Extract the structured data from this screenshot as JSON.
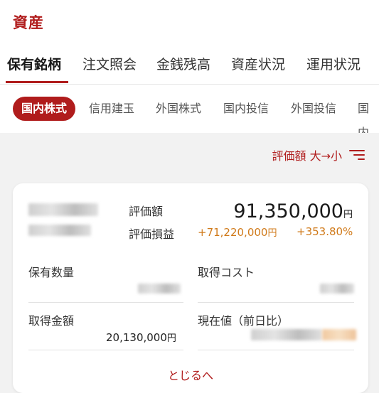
{
  "header": {
    "title": "資産"
  },
  "tabs": [
    {
      "label": "保有銘柄",
      "active": true
    },
    {
      "label": "注文照会",
      "active": false
    },
    {
      "label": "金銭残高",
      "active": false
    },
    {
      "label": "資産状況",
      "active": false
    },
    {
      "label": "運用状況",
      "active": false
    }
  ],
  "subtabs": [
    {
      "label": "国内株式",
      "active": true
    },
    {
      "label": "信用建玉",
      "active": false
    },
    {
      "label": "外国株式",
      "active": false
    },
    {
      "label": "国内投信",
      "active": false
    },
    {
      "label": "外国投信",
      "active": false
    },
    {
      "label": "国内",
      "active": false
    }
  ],
  "sort": {
    "label": "評価額 大→小"
  },
  "card": {
    "valuation_label": "評価額",
    "valuation_value": "91,350,000",
    "yen_unit": "円",
    "pl_label": "評価損益",
    "pl_value": "+71,220,000",
    "pl_percent": "+353.80%",
    "qty_label": "保有数量",
    "cost_label": "取得コスト",
    "acq_label": "取得金額",
    "acq_value": "20,130,000",
    "price_label": "現在値（前日比）",
    "close_label": "とじるへ"
  },
  "colors": {
    "accent": "#b01c1c",
    "profit": "#d07a1a"
  }
}
